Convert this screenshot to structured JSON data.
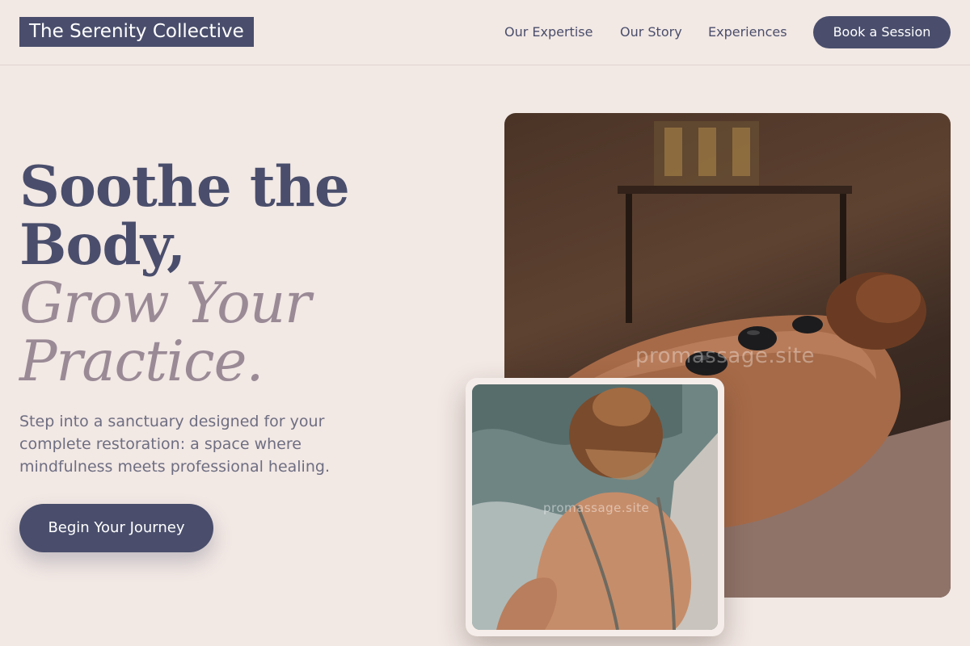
{
  "header": {
    "brand": "The Serenity Collective",
    "nav": [
      {
        "label": "Our Expertise"
      },
      {
        "label": "Our Story"
      },
      {
        "label": "Experiences"
      }
    ],
    "cta_label": "Book a Session"
  },
  "hero": {
    "title_line1": "Soothe the",
    "title_line2": "Body,",
    "title_line3": "Grow Your",
    "title_line4": "Practice.",
    "subtitle": "Step into a sanctuary designed for your complete restoration: a space where mindfulness meets professional healing.",
    "cta_label": "Begin Your Journey"
  },
  "images": {
    "main_watermark": "promassage.site",
    "inset_watermark": "promassage.site"
  },
  "colors": {
    "background": "#f2e8e4",
    "primary": "#4a4e6c",
    "accent_muted": "#9a8a96",
    "text_muted": "#6e6e82"
  }
}
